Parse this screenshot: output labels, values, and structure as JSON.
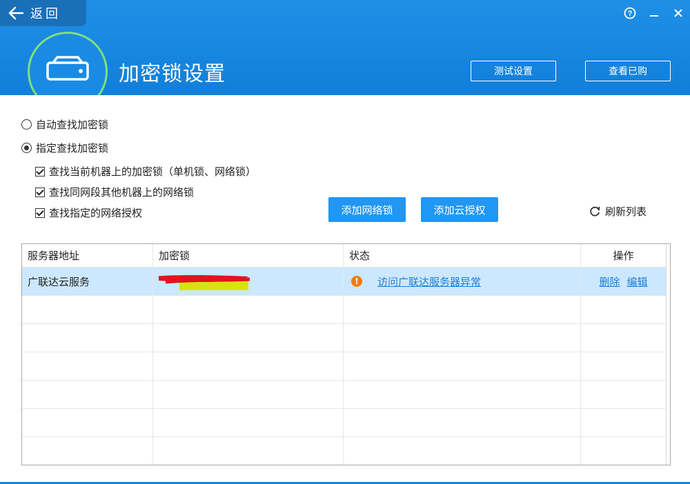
{
  "header": {
    "back_label": "返回",
    "title": "加密锁设置",
    "test_button": "测试设置",
    "bought_button": "查看已购",
    "icons": [
      "back-arrow-icon",
      "help-icon",
      "minimize-icon",
      "close-icon",
      "dongle-icon"
    ]
  },
  "options": {
    "auto_find": "自动查找加密锁",
    "specify_find": "指定查找加密锁",
    "selected_radio": "specify_find",
    "check_local": "查找当前机器上的加密锁（单机锁、网络锁）",
    "check_segment": "查找同网段其他机器上的网络锁",
    "check_auth": "查找指定的网络授权",
    "checks_state": [
      true,
      true,
      true
    ]
  },
  "actions": {
    "add_network_lock": "添加网络锁",
    "add_cloud_auth": "添加云授权",
    "refresh_list": "刷新列表"
  },
  "table": {
    "columns": [
      "服务器地址",
      "加密锁",
      "状态",
      "操作"
    ],
    "rows": [
      {
        "server": "广联达云服务",
        "lock": "",
        "status_text": "访问广联达服务器异常",
        "status_icon": "warning-icon",
        "delete_label": "删除",
        "edit_label": "编辑",
        "selected": true
      }
    ],
    "empty_rows": 6
  },
  "colors": {
    "header_blue": "#1585dd",
    "button_blue": "#2196f3",
    "selected_row": "#cce8ff",
    "link": "#1a7fd8",
    "warning": "#ef7d10",
    "ring_green": "#7fe07a"
  }
}
